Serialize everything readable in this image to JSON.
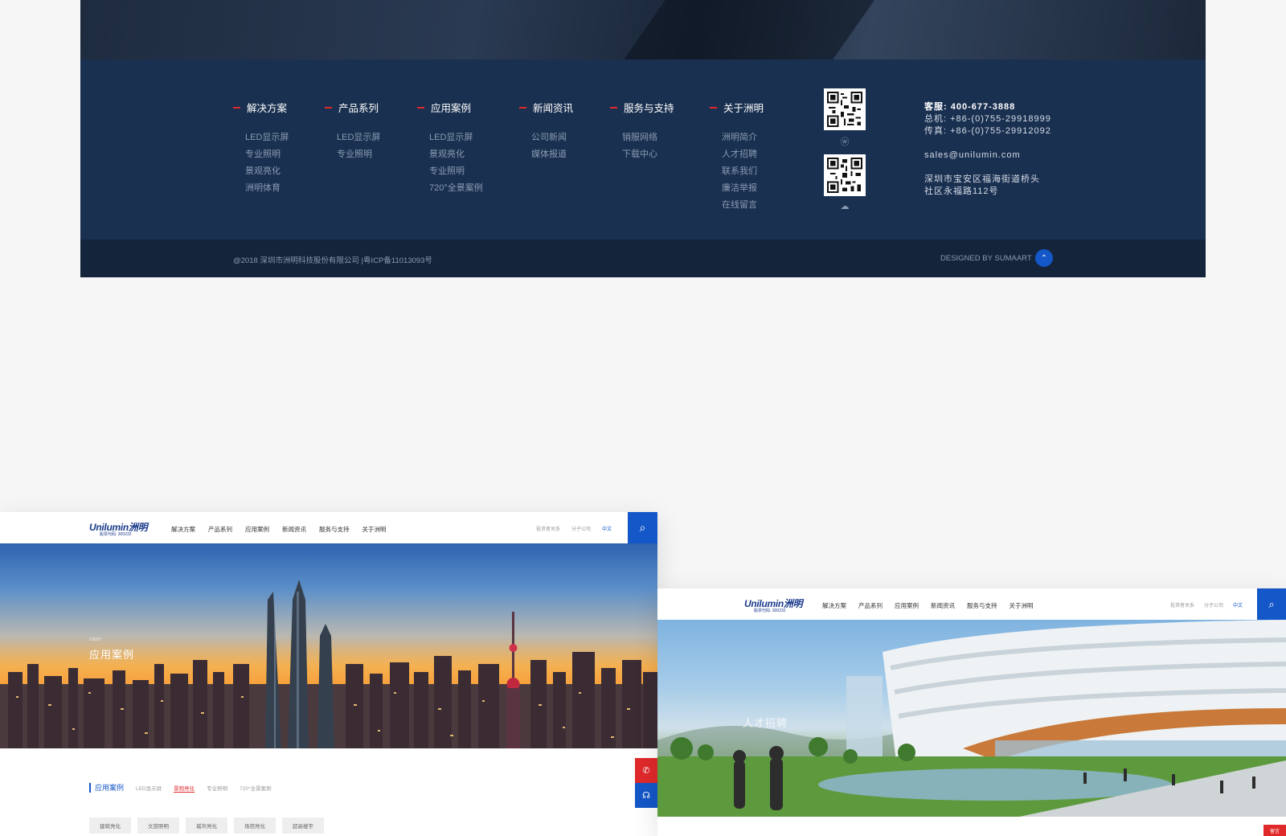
{
  "footer": {
    "columns": [
      {
        "title": "解决方案",
        "links": [
          "LED显示屏",
          "专业照明",
          "景观亮化",
          "洲明体育"
        ]
      },
      {
        "title": "产品系列",
        "links": [
          "LED显示屏",
          "专业照明"
        ]
      },
      {
        "title": "应用案例",
        "links": [
          "LED显示屏",
          "景观亮化",
          "专业照明",
          "720°全景案例"
        ]
      },
      {
        "title": "新闻资讯",
        "links": [
          "公司新闻",
          "媒体报道"
        ]
      },
      {
        "title": "服务与支持",
        "links": [
          "销服网络",
          "下载中心"
        ]
      },
      {
        "title": "关于洲明",
        "links": [
          "洲明简介",
          "人才招聘",
          "联系我们",
          "廉洁举报",
          "在线留言"
        ]
      }
    ],
    "qr": [
      {
        "icon": "weibo-icon",
        "glyph": "ⓦ"
      },
      {
        "icon": "wechat-icon",
        "glyph": "☁"
      }
    ],
    "contact": {
      "hotline_label": "客服:",
      "hotline": "400-677-3888",
      "switchboard": "总机: +86-(0)755-29918999",
      "fax": "传真: +86-(0)755-29912092",
      "email": "sales@unilumin.com",
      "address_line1": "深圳市宝安区福海街道桥头",
      "address_line2": "社区永福路112号"
    },
    "copyright": "@2018 深圳市洲明科技股份有限公司 |粤ICP备11013093号",
    "designed_by": "DESIGNED BY SUMAART",
    "back_to_top_glyph": "⌃"
  },
  "site": {
    "logo": "Unilumin洲明",
    "logo_sub": "股票代码: 300232",
    "nav": [
      "解决方案",
      "产品系列",
      "应用案例",
      "新闻资讯",
      "服务与支持",
      "关于洲明"
    ],
    "nav_right": [
      "投资者关系",
      "分子公司",
      "中文"
    ],
    "search_glyph": "⌕"
  },
  "shotA": {
    "hero_en": "case",
    "hero_title": "应用案例",
    "subnav_current": "应用案例",
    "subnav_items": [
      "LED显示屏",
      "景观亮化",
      "专业照明",
      "720°全景案例"
    ],
    "subnav_active_index": 1,
    "tags": [
      "建筑亮化",
      "文旅照明",
      "城市亮化",
      "场馆亮化",
      "超高楼宇"
    ],
    "side_buttons": [
      {
        "icon": "phone-icon",
        "glyph": "✆",
        "color": "#e0292b"
      },
      {
        "icon": "service-icon",
        "glyph": "☊",
        "color": "#1457c8"
      }
    ]
  },
  "shotB": {
    "hero_title": "人才招聘",
    "corner_label": "留言"
  },
  "colors": {
    "footer_bg": "#1a3050",
    "accent_red": "#e0292b",
    "brand_blue": "#1457c8"
  }
}
